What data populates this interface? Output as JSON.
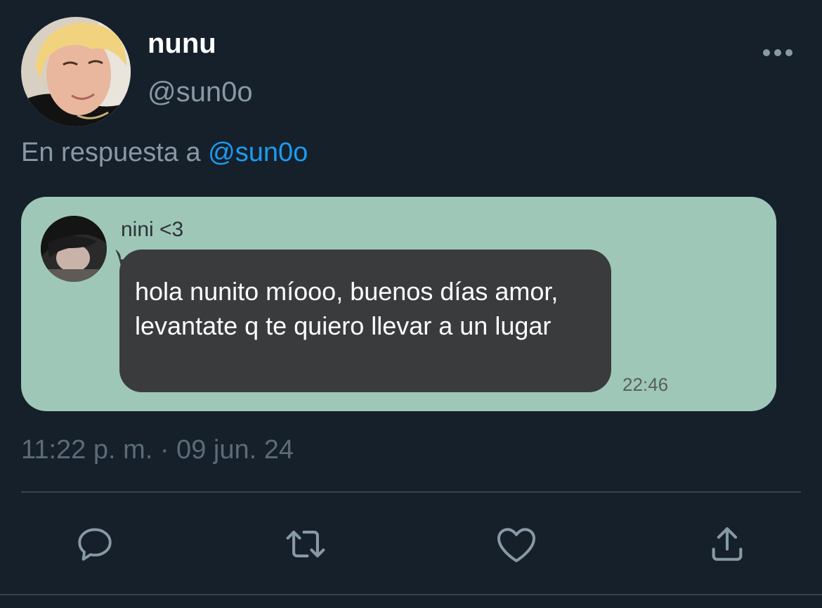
{
  "tweet": {
    "display_name": "nunu",
    "handle": "@sun0o",
    "reply_prefix": "En respuesta a",
    "reply_mention": "@sun0o",
    "timestamp": "11:22 p. m. · 09 jun. 24"
  },
  "embedded_chat": {
    "sender": "nini <3",
    "message": "hola nunito míooo, buenos días amor, levantate q te quiero llevar a un lugar",
    "time": "22:46"
  },
  "icons": {
    "more": "more-horizontal-icon",
    "reply": "reply-icon",
    "retweet": "retweet-icon",
    "like": "heart-icon",
    "share": "share-icon"
  },
  "colors": {
    "background": "#15202b",
    "mention": "#1d9bf0",
    "chat_card": "#9fc7b7",
    "chat_bubble": "#3a3b3d",
    "muted": "#8899a6"
  }
}
